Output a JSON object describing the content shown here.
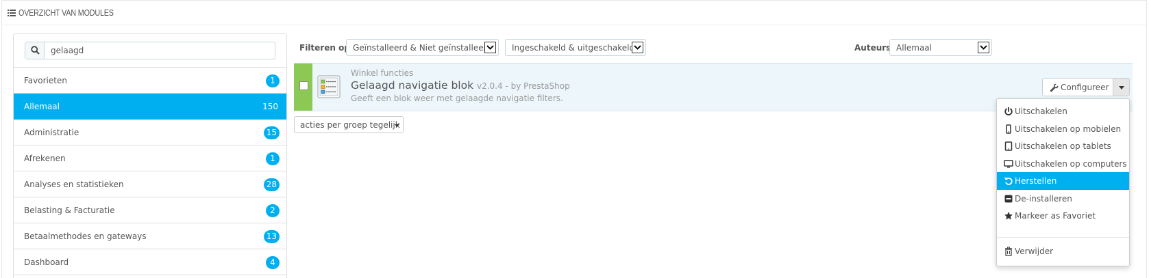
{
  "panel": {
    "title": "OVERZICHT VAN MODULES"
  },
  "search": {
    "value": "gelaagd"
  },
  "categories": [
    {
      "label": "Favorieten",
      "count": "1"
    },
    {
      "label": "Allemaal",
      "count": "150",
      "active": true
    },
    {
      "label": "Administratie",
      "count": "15"
    },
    {
      "label": "Afrekenen",
      "count": "1"
    },
    {
      "label": "Analyses en statistieken",
      "count": "28"
    },
    {
      "label": "Belasting & Facturatie",
      "count": "2"
    },
    {
      "label": "Betaalmethodes en gateways",
      "count": "13"
    },
    {
      "label": "Dashboard",
      "count": "4"
    }
  ],
  "filters": {
    "filter_label": "Filteren op",
    "install_select": "Geïnstalleerd & Niet geïnstalleerd",
    "enable_select": "Ingeschakeld & uitgeschakeld",
    "authors_label": "Auteurs",
    "authors_select": "Allemaal"
  },
  "module": {
    "category": "Winkel functies",
    "name": "Gelaagd navigatie blok",
    "version": "v2.0.4 - by PrestaShop",
    "description": "Geeft een blok weer met gelaagde navigatie filters.",
    "configure_label": "Configureer"
  },
  "bulk": {
    "label": "acties per groep tegelijk"
  },
  "menu": {
    "items": [
      {
        "label": "Uitschakelen",
        "icon": "power-icon"
      },
      {
        "label": "Uitschakelen op mobielen",
        "icon": "mobile-icon"
      },
      {
        "label": "Uitschakelen op tablets",
        "icon": "tablet-icon"
      },
      {
        "label": "Uitschakelen op computers",
        "icon": "desktop-icon"
      },
      {
        "label": "Herstellen",
        "icon": "undo-icon",
        "highlight": true
      },
      {
        "label": "De-installeren",
        "icon": "minus-square-icon"
      },
      {
        "label": "Markeer as Favoriet",
        "icon": "star-icon"
      }
    ],
    "delete_label": "Verwijder"
  },
  "colors": {
    "accent": "#00aff0",
    "installed_bar": "#8bc954",
    "row_bg": "#edf7fb"
  }
}
